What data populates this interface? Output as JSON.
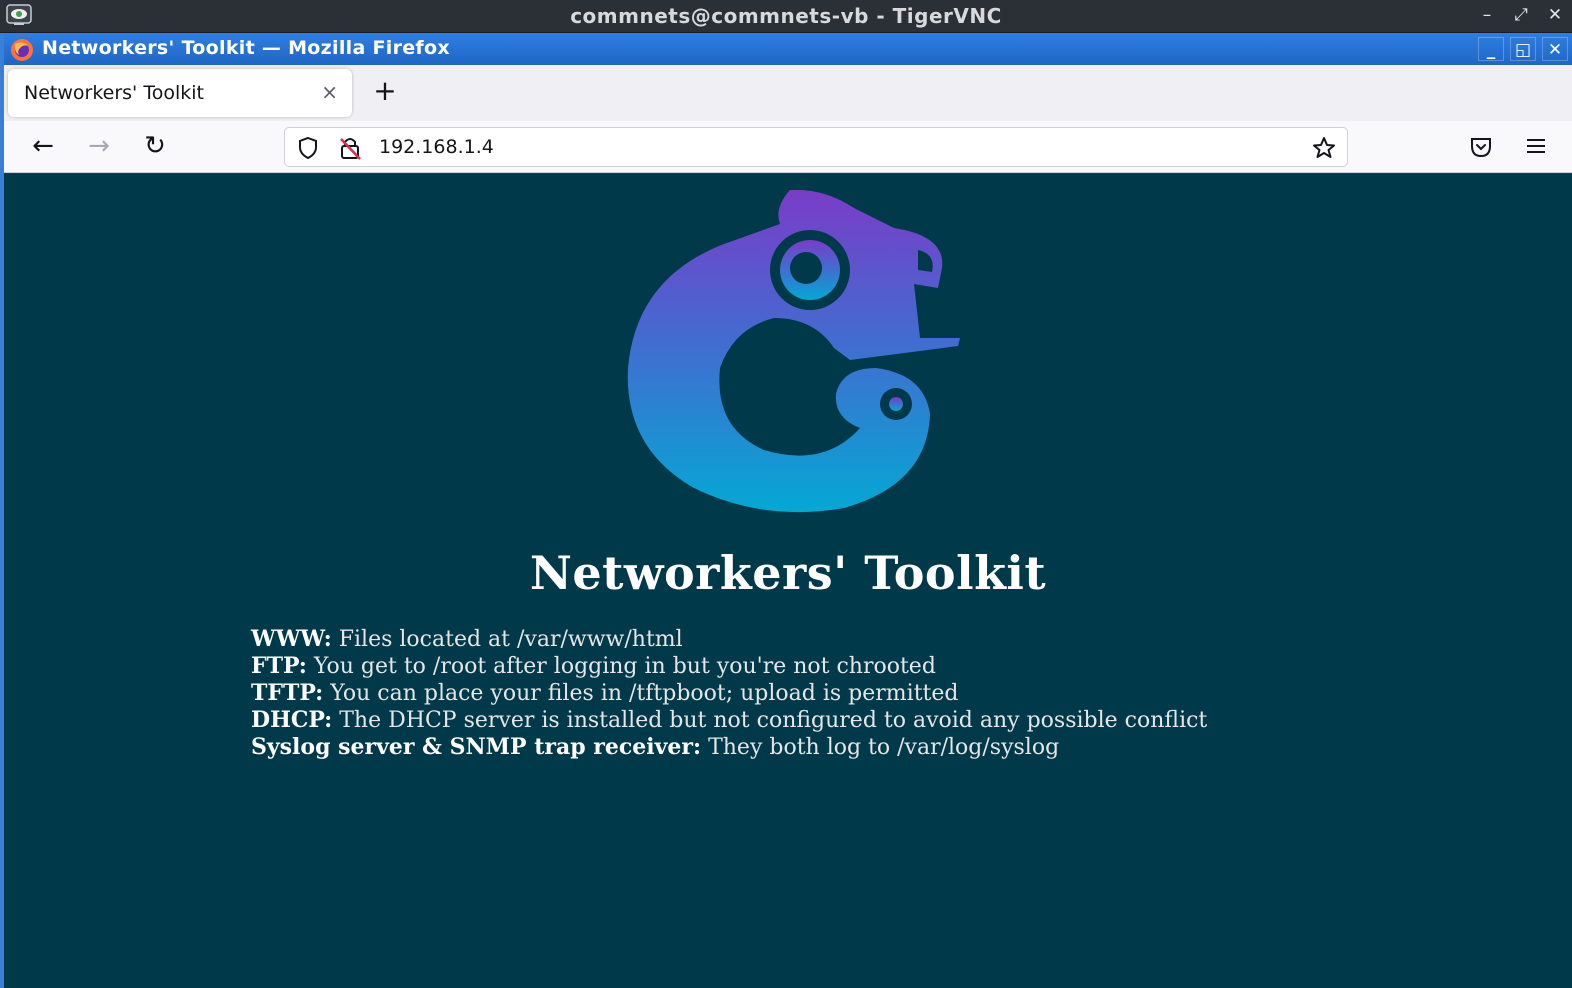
{
  "vnc": {
    "title": "commnets@commnets-vb - TigerVNC",
    "controls": {
      "minimize": "–",
      "maximize": "⤢",
      "close": "✕"
    }
  },
  "firefox": {
    "window_title": "Networkers' Toolkit — Mozilla Firefox",
    "controls": {
      "minimize": "_",
      "restore": "◱",
      "close": "✕"
    },
    "tab": {
      "label": "Networkers' Toolkit",
      "close": "×"
    },
    "newtab": "+",
    "nav": {
      "back": "←",
      "forward": "→",
      "reload": "↻"
    },
    "url": "192.168.1.4"
  },
  "page": {
    "heading": "Networkers' Toolkit",
    "services": [
      {
        "key": "WWW:",
        "text": " Files located at /var/www/html"
      },
      {
        "key": "FTP:",
        "text": " You get to /root after logging in but you're not chrooted"
      },
      {
        "key": "TFTP:",
        "text": " You can place your files in /tftpboot; upload is permitted"
      },
      {
        "key": "DHCP:",
        "text": " The DHCP server is installed but not configured to avoid any possible conflict"
      },
      {
        "key": "Syslog server & SNMP trap receiver:",
        "text": " They both log to /var/log/syslog"
      }
    ]
  },
  "colors": {
    "page_bg": "#003a4a",
    "logo_top": "#7a3cc8",
    "logo_bottom": "#04a8d4",
    "firefox_title": "#1f66c6"
  },
  "icons": [
    "vnc-app-icon",
    "firefox-logo-icon",
    "back-icon",
    "forward-icon",
    "reload-icon",
    "shield-icon",
    "insecure-lock-icon",
    "bookmark-star-icon",
    "pocket-icon",
    "hamburger-menu-icon",
    "chameleon-logo"
  ]
}
